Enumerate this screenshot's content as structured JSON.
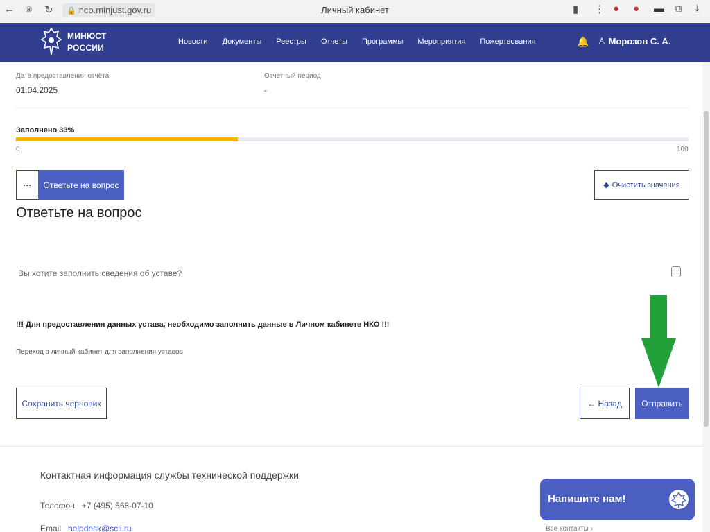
{
  "browser": {
    "back": "←",
    "forward": "⑧",
    "reload": "↻",
    "url": "nco.minjust.gov.ru",
    "title": "Личный кабинет",
    "ext_icons": [
      "bookmark-icon",
      "menu-dots-icon",
      "extension-icon",
      "extension-icon",
      "shield-icon",
      "puzzle-icon",
      "download-icon"
    ]
  },
  "header": {
    "brand_line1": "МИНЮСТ",
    "brand_line2": "РОССИИ",
    "menu": [
      "Новости",
      "Документы",
      "Реестры",
      "Отчеты",
      "Программы",
      "Мероприятия",
      "Пожертвования"
    ],
    "user_name": "Морозов С. А."
  },
  "report": {
    "date_label": "Дата предоставления отчёта",
    "date_value": "01.04.2025",
    "period_label": "Отчетный период",
    "period_value": "-"
  },
  "progress": {
    "label": "Заполнено 33%",
    "value": 0.33,
    "min": "0",
    "max": "100"
  },
  "toolbar": {
    "more": "···",
    "answer_tab": "Ответьте на вопрос",
    "clear": "Очистить значения"
  },
  "form": {
    "heading": "Ответьте на вопрос",
    "question": "Вы хотите заполнить сведения об уставе?",
    "notice": "!!! Для предоставления данных устава, необходимо заполнить данные в Личном кабинете НКО !!!",
    "link": "Переход в личный кабинет для заполнения уставов"
  },
  "actions": {
    "save_draft": "Сохранить черновик",
    "back": "← Назад",
    "submit": "Отправить"
  },
  "footer": {
    "title": "Контактная информация службы технической поддержки",
    "phone_label": "Телефон",
    "phone": "+7 (495) 568-07-10",
    "email_label": "Email",
    "email": "helpdesk@scli.ru",
    "contacts_link": "Все контакты ›"
  },
  "chat": {
    "label": "Напишите нам!"
  },
  "colors": {
    "header_bg": "#2f3e8f",
    "primary": "#4a5fc1",
    "progress": "#f4b400",
    "arrow": "#22a03a"
  }
}
